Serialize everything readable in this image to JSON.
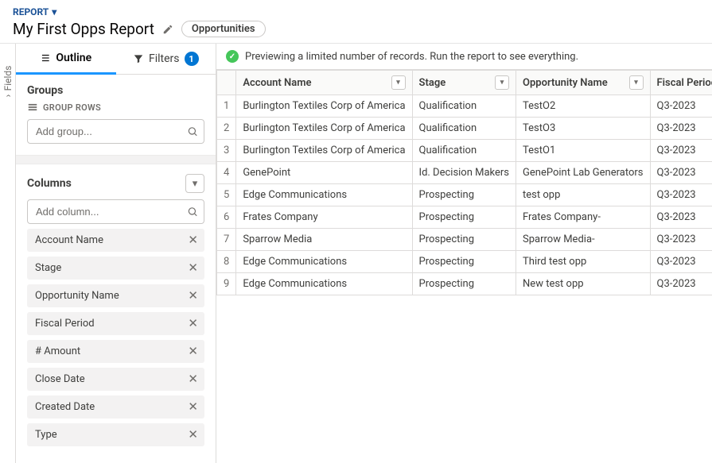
{
  "header": {
    "report_label": "REPORT",
    "title": "My First Opps Report",
    "entity_pill": "Opportunities"
  },
  "fields_rail": {
    "label": "Fields"
  },
  "sidebar": {
    "tabs": {
      "outline": "Outline",
      "filters": "Filters",
      "filters_count": "1"
    },
    "groups": {
      "heading": "Groups",
      "rows_label": "GROUP ROWS",
      "add_placeholder": "Add group..."
    },
    "columns": {
      "heading": "Columns",
      "add_placeholder": "Add column...",
      "items": [
        {
          "label": "Account Name"
        },
        {
          "label": "Stage"
        },
        {
          "label": "Opportunity Name"
        },
        {
          "label": "Fiscal Period"
        },
        {
          "label": "# Amount"
        },
        {
          "label": "Close Date"
        },
        {
          "label": "Created Date"
        },
        {
          "label": "Type"
        }
      ]
    }
  },
  "preview_message": "Previewing a limited number of records. Run the report to see everything.",
  "table": {
    "headers": [
      "Account Name",
      "Stage",
      "Opportunity Name",
      "Fiscal Period"
    ],
    "rows": [
      {
        "n": "1",
        "cells": [
          "Burlington Textiles Corp of America",
          "Qualification",
          "TestO2",
          "Q3-2023"
        ]
      },
      {
        "n": "2",
        "cells": [
          "Burlington Textiles Corp of America",
          "Qualification",
          "TestO3",
          "Q3-2023"
        ]
      },
      {
        "n": "3",
        "cells": [
          "Burlington Textiles Corp of America",
          "Qualification",
          "TestO1",
          "Q3-2023"
        ]
      },
      {
        "n": "4",
        "cells": [
          "GenePoint",
          "Id. Decision Makers",
          "GenePoint Lab Generators",
          "Q3-2023"
        ]
      },
      {
        "n": "5",
        "cells": [
          "Edge Communications",
          "Prospecting",
          "test opp",
          "Q3-2023"
        ]
      },
      {
        "n": "6",
        "cells": [
          "Frates Company",
          "Prospecting",
          "Frates Company-",
          "Q3-2023"
        ]
      },
      {
        "n": "7",
        "cells": [
          "Sparrow Media",
          "Prospecting",
          "Sparrow Media-",
          "Q3-2023"
        ]
      },
      {
        "n": "8",
        "cells": [
          "Edge Communications",
          "Prospecting",
          "Third test opp",
          "Q3-2023"
        ]
      },
      {
        "n": "9",
        "cells": [
          "Edge Communications",
          "Prospecting",
          "New test opp",
          "Q3-2023"
        ]
      }
    ]
  }
}
